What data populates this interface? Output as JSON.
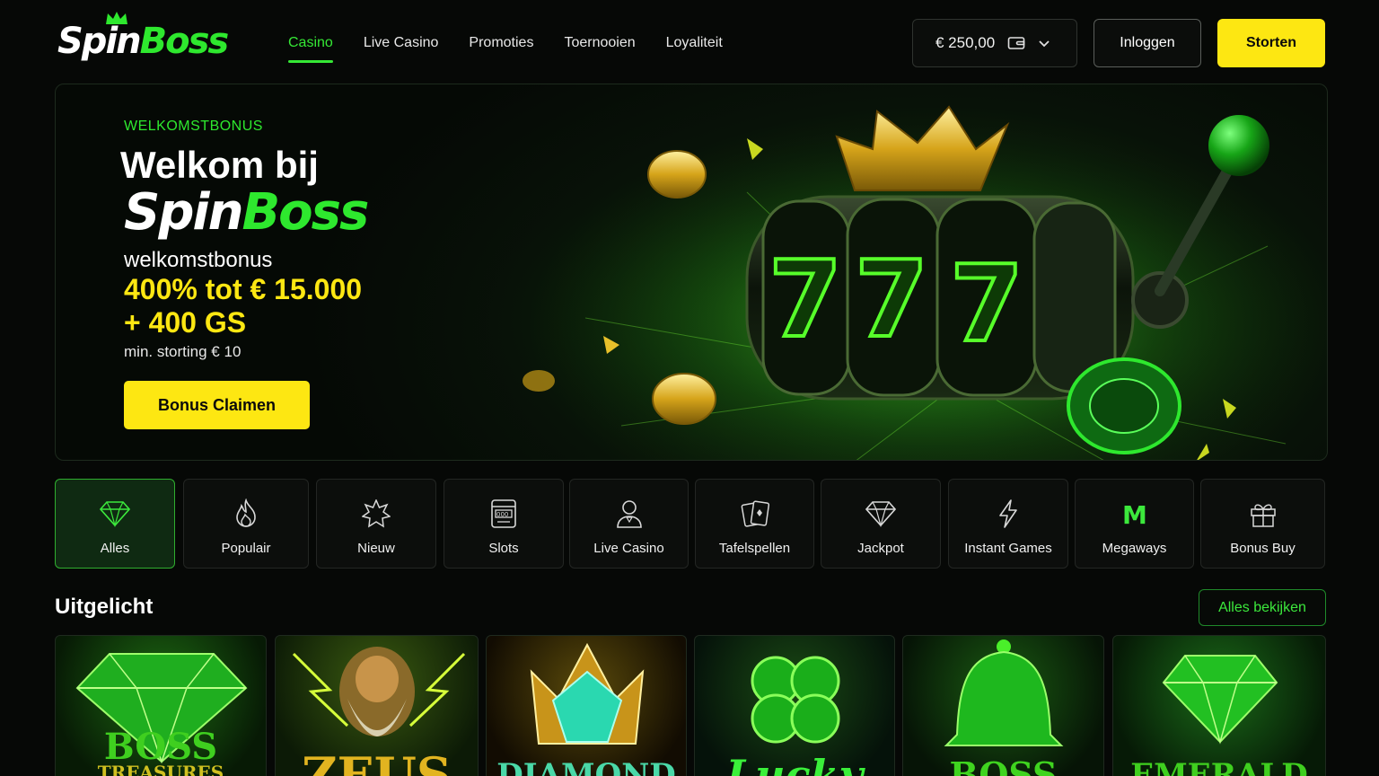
{
  "header": {
    "logo": {
      "spin": "Spin",
      "boss": "Boss"
    },
    "nav": [
      {
        "label": "Casino",
        "active": true
      },
      {
        "label": "Live Casino",
        "active": false
      },
      {
        "label": "Promoties",
        "active": false
      },
      {
        "label": "Toernooien",
        "active": false
      },
      {
        "label": "Loyaliteit",
        "active": false
      }
    ],
    "balance": "€ 250,00",
    "login_label": "Inloggen",
    "deposit_label": "Storten"
  },
  "hero": {
    "eyebrow": "WELKOMSTBONUS",
    "title_line1": "Welkom bij",
    "title_spin": "Spin",
    "title_boss": "Boss",
    "sub": "welkomstbonus",
    "offer_line1": "400% tot € 15.000",
    "offer_line2": "+ 400 GS",
    "min_deposit": "min. storting € 10",
    "cta_label": "Bonus Claimen"
  },
  "categories": [
    {
      "label": "Alles",
      "icon": "diamond-icon",
      "active": true
    },
    {
      "label": "Populair",
      "icon": "flame-icon",
      "active": false
    },
    {
      "label": "Nieuw",
      "icon": "star-burst-icon",
      "active": false
    },
    {
      "label": "Slots",
      "icon": "slot-machine-icon",
      "active": false
    },
    {
      "label": "Live Casino",
      "icon": "dealer-icon",
      "active": false
    },
    {
      "label": "Tafelspellen",
      "icon": "cards-icon",
      "active": false
    },
    {
      "label": "Jackpot",
      "icon": "diamond-icon",
      "active": false
    },
    {
      "label": "Instant Games",
      "icon": "lightning-icon",
      "active": false
    },
    {
      "label": "Megaways",
      "icon": "megaways-m-icon",
      "active": false
    },
    {
      "label": "Bonus Buy",
      "icon": "gift-icon",
      "active": false
    }
  ],
  "featured": {
    "title": "Uitgelicht",
    "view_all_label": "Alles bekijken",
    "games": [
      {
        "title": "BOSS",
        "subtitle": "TREASURES",
        "art": "emerald-diamond"
      },
      {
        "title": "ZEUS",
        "art": "zeus-portrait"
      },
      {
        "title": "DIAMOND",
        "art": "crowned-gem"
      },
      {
        "title": "Lucky",
        "art": "clover"
      },
      {
        "title": "BOSS",
        "art": "bell"
      },
      {
        "title": "EMERALD",
        "art": "emerald-diamond"
      }
    ]
  },
  "colors": {
    "accent_green": "#2ee82e",
    "accent_yellow": "#fde712",
    "background": "#060806"
  }
}
